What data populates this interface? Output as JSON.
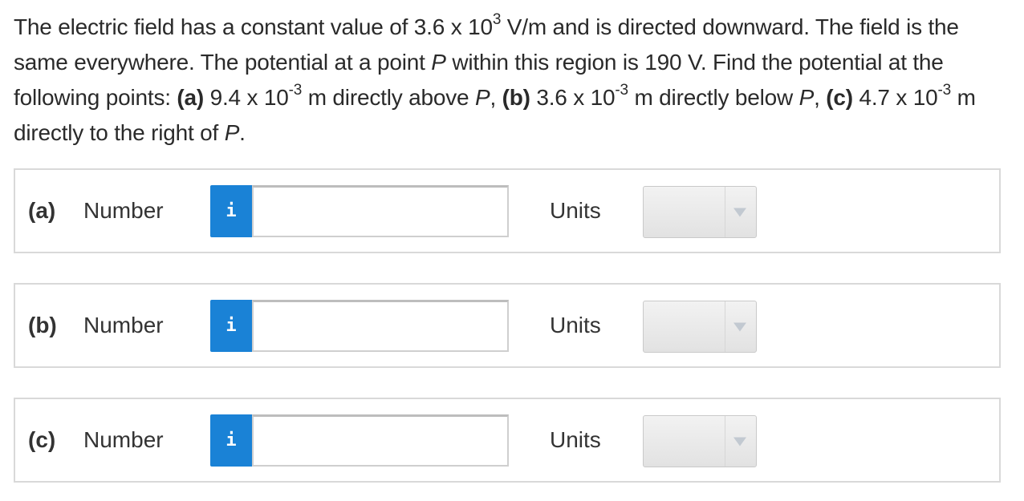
{
  "question": {
    "p1": "The electric field has a constant value of 3.6 x 10",
    "exp1": "3",
    "p2": " V/m and is directed downward. The field is the same everywhere. The potential at a point ",
    "point_var": "P",
    "p3": " within this region is 190 V. Find the potential at the following points: ",
    "a_label": "(a)",
    "p4": " 9.4 x 10",
    "exp2": "-3",
    "p5": " m directly above ",
    "p5_var": "P",
    "p5_end": ", ",
    "b_label": "(b)",
    "p6": " 3.6 x 10",
    "exp3": "-3",
    "p7": " m directly below ",
    "p7_var": "P",
    "p7_end": ", ",
    "c_label": "(c)",
    "p8": " 4.7 x 10",
    "exp4": "-3",
    "p9": " m directly to the right of ",
    "p9_var": "P",
    "p9_end": "."
  },
  "answers": [
    {
      "label": "(a)",
      "number_label": "Number",
      "info_icon": "i",
      "value": "",
      "units_label": "Units",
      "units_value": ""
    },
    {
      "label": "(b)",
      "number_label": "Number",
      "info_icon": "i",
      "value": "",
      "units_label": "Units",
      "units_value": ""
    },
    {
      "label": "(c)",
      "number_label": "Number",
      "info_icon": "i",
      "value": "",
      "units_label": "Units",
      "units_value": ""
    }
  ],
  "colors": {
    "info_button": "#1a82d6",
    "border": "#d9d9d9",
    "select_arrow": "#c2c9d1"
  }
}
